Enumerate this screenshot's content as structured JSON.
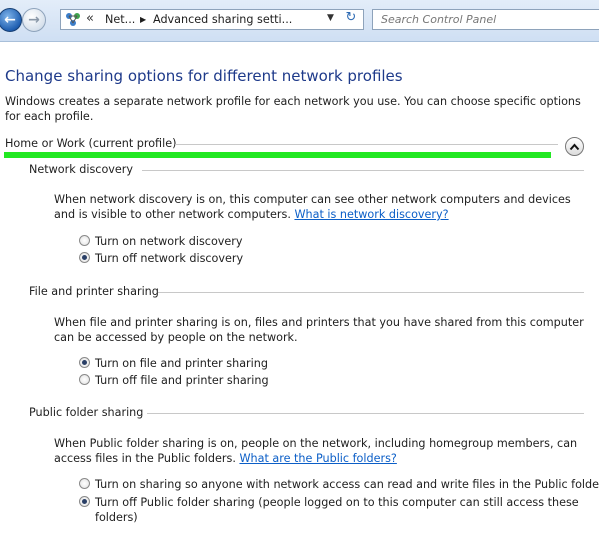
{
  "address_bar": {
    "chevrons": "«",
    "crumbs": [
      "Net...",
      "Advanced sharing setti..."
    ],
    "separator": "▶",
    "dropdown": "▼",
    "refresh": "↻"
  },
  "search": {
    "placeholder": "Search Control Panel"
  },
  "page": {
    "title": "Change sharing options for different network profiles",
    "description": "Windows creates a separate network profile for each network you use. You can choose specific options for each profile."
  },
  "profile": {
    "label": "Home or Work (current profile)",
    "collapse_icon": "⌃"
  },
  "sections": {
    "network_discovery": {
      "title": "Network discovery",
      "description": "When network discovery is on, this computer can see other network computers and devices and is visible to other network computers.",
      "link": "What is network discovery?",
      "options": [
        {
          "label": "Turn on network discovery",
          "checked": false
        },
        {
          "label": "Turn off network discovery",
          "checked": true
        }
      ]
    },
    "file_printer": {
      "title": "File and printer sharing",
      "description": "When file and printer sharing is on, files and printers that you have shared from this computer can be accessed by people on the network.",
      "options": [
        {
          "label": "Turn on file and printer sharing",
          "checked": true
        },
        {
          "label": "Turn off file and printer sharing",
          "checked": false
        }
      ]
    },
    "public_folder": {
      "title": "Public folder sharing",
      "description": "When Public folder sharing is on, people on the network, including homegroup members, can access files in the Public folders.",
      "link": "What are the Public folders?",
      "options": [
        {
          "label": "Turn on sharing so anyone with network access can read and write files in the Public folders",
          "checked": false
        },
        {
          "label": "Turn off Public folder sharing (people logged on to this computer can still access these folders)",
          "checked": true
        }
      ]
    }
  },
  "colors": {
    "title_blue": "#1e3a8a",
    "link_blue": "#0b5ec7",
    "highlight_green": "#22e822"
  },
  "icons": {
    "back": "back-arrow-icon",
    "forward": "forward-arrow-icon",
    "location": "network-icon",
    "refresh": "refresh-icon",
    "collapse": "chevron-up-icon"
  }
}
